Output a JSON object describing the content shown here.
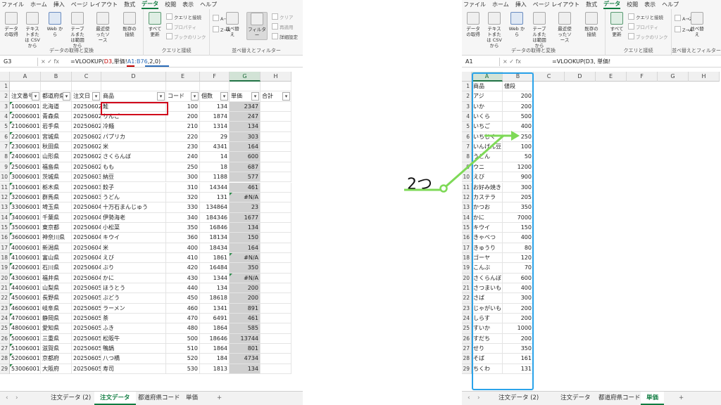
{
  "menu": [
    "ファイル",
    "ホーム",
    "挿入",
    "ページ レイアウト",
    "数式",
    "データ",
    "校閲",
    "表示",
    "ヘルプ"
  ],
  "menu_active": "データ",
  "ribbon": {
    "get_data": "データの取得",
    "text_csv": "テキストまたは CSV から",
    "web": "Web から",
    "table_range": "テーブルまたは範囲から",
    "recent_sources": "最近使ったソース",
    "existing_conn": "既存の接続",
    "group_get_transform": "データの取得と変換",
    "refresh_all": "すべて更新",
    "queries_conn": "クエリと接続",
    "properties": "プロパティ",
    "edit_links": "ブックのリンク",
    "group_queries": "クエリと接続",
    "sort_az": "A→Z",
    "sort_za": "Z→A",
    "sort": "並べ替え",
    "filter": "フィルター",
    "clear": "クリア",
    "reapply": "再適用",
    "advanced": "詳細設定",
    "group_sort_filter": "並べ替えとフィルター"
  },
  "left": {
    "namebox": "G3",
    "fx": "× ✓ fx",
    "formula_pre": "=VLOOKUP(",
    "formula_ref1": "D3",
    "formula_mid": ",単価!",
    "formula_ref2": "A1:B76",
    "formula_post": ",2,0)",
    "columns": [
      "A",
      "B",
      "C",
      "D",
      "E",
      "F",
      "G",
      "H"
    ],
    "headers": [
      "注文番号",
      "都道府県",
      "注文日",
      "商品",
      "コード",
      "個数",
      "単価",
      "合計"
    ],
    "rows": [
      [
        "10006001",
        "北海道",
        "20250602",
        "鮭",
        "100",
        "134",
        "2347"
      ],
      [
        "20006001",
        "青森県",
        "20250602",
        "りんご",
        "200",
        "1874",
        "247"
      ],
      [
        "21006001",
        "岩手県",
        "20250602",
        "冷麺",
        "210",
        "1314",
        "134"
      ],
      [
        "22006001",
        "宮城県",
        "20250602",
        "パプリカ",
        "220",
        "29",
        "303"
      ],
      [
        "23006001",
        "秋田県",
        "20250602",
        "米",
        "230",
        "4341",
        "164"
      ],
      [
        "24006001",
        "山形県",
        "20250602",
        "さくらんぼ",
        "240",
        "14",
        "600"
      ],
      [
        "25006001",
        "福島県",
        "20250602",
        "もも",
        "250",
        "18",
        "687"
      ],
      [
        "30006001",
        "茨城県",
        "20250603",
        "納豆",
        "300",
        "1188",
        "577"
      ],
      [
        "31006001",
        "栃木県",
        "20250603",
        "餃子",
        "310",
        "14344",
        "461"
      ],
      [
        "32006001",
        "群馬県",
        "20250603",
        "うどん",
        "320",
        "131",
        "#N/A"
      ],
      [
        "33006001",
        "埼玉県",
        "20250604",
        "十万石まんじゅう",
        "330",
        "134864",
        "23"
      ],
      [
        "34006001",
        "千葉県",
        "20250604",
        "伊勢海老",
        "340",
        "184346",
        "1677"
      ],
      [
        "35006001",
        "東京都",
        "20250604",
        "小松菜",
        "350",
        "16846",
        "134"
      ],
      [
        "36006001",
        "神奈川県",
        "20250604",
        "キウイ",
        "360",
        "18134",
        "150"
      ],
      [
        "40006001",
        "新潟県",
        "20250604",
        "米",
        "400",
        "18434",
        "164"
      ],
      [
        "41006001",
        "富山県",
        "20250604",
        "えび",
        "410",
        "1861",
        "#N/A"
      ],
      [
        "42006001",
        "石川県",
        "20250604",
        "ぶり",
        "420",
        "16484",
        "350"
      ],
      [
        "43006001",
        "福井県",
        "20250604",
        "かに",
        "430",
        "1344",
        "#N/A"
      ],
      [
        "44006001",
        "山梨県",
        "20250605",
        "ほうとう",
        "440",
        "134",
        "200"
      ],
      [
        "45006001",
        "長野県",
        "20250605",
        "ぶどう",
        "450",
        "18618",
        "200"
      ],
      [
        "46006001",
        "岐阜県",
        "20250605",
        "ラーメン",
        "460",
        "1341",
        "891"
      ],
      [
        "47006001",
        "静岡県",
        "20250605",
        "茶",
        "470",
        "6491",
        "461"
      ],
      [
        "48006001",
        "愛知県",
        "20250605",
        "ふき",
        "480",
        "1864",
        "585"
      ],
      [
        "50006001",
        "三重県",
        "20250605",
        "松阪牛",
        "500",
        "18646",
        "13744"
      ],
      [
        "51006001",
        "滋賀県",
        "20250605",
        "鴨鍋",
        "510",
        "1864",
        "801"
      ],
      [
        "52006001",
        "京都府",
        "20250605",
        "八つ橋",
        "520",
        "184",
        "4734"
      ],
      [
        "53006001",
        "大阪府",
        "20250605",
        "寿司",
        "530",
        "1813",
        "134"
      ]
    ],
    "tabs": [
      "注文データ (2)",
      "注文データ",
      "都道府県コード",
      "単価",
      "+"
    ],
    "active_tab": "注文データ"
  },
  "right": {
    "namebox": "A1",
    "fx": "× ✓ fx",
    "formula_pre": "=VLOOKUP(",
    "formula_ref1": "D3",
    "formula_mid": ", 単価!",
    "columns": [
      "A",
      "B",
      "C",
      "D",
      "E",
      "F",
      "G",
      "H"
    ],
    "headers": [
      "商品",
      "値段"
    ],
    "rows": [
      [
        "アジ",
        "200"
      ],
      [
        "いか",
        "200"
      ],
      [
        "いくら",
        "500"
      ],
      [
        "いちご",
        "400"
      ],
      [
        "いちじく",
        "250"
      ],
      [
        "いんげん豆",
        "100"
      ],
      [
        "うどん",
        "50"
      ],
      [
        "ウニ",
        "1200"
      ],
      [
        "えび",
        "900"
      ],
      [
        "お好み焼き",
        "300"
      ],
      [
        "カステラ",
        "205"
      ],
      [
        "かつお",
        "350"
      ],
      [
        "かに",
        "7000"
      ],
      [
        "キウイ",
        "150"
      ],
      [
        "きゃべつ",
        "400"
      ],
      [
        "きゅうり",
        "80"
      ],
      [
        "ゴーヤ",
        "120"
      ],
      [
        "こんぶ",
        "70"
      ],
      [
        "さくらんぼ",
        "600"
      ],
      [
        "さつまいも",
        "400"
      ],
      [
        "さば",
        "300"
      ],
      [
        "じゃがいも",
        "200"
      ],
      [
        "しらす",
        "200"
      ],
      [
        "すいか",
        "1000"
      ],
      [
        "すだち",
        "200"
      ],
      [
        "せり",
        "350"
      ],
      [
        "そば",
        "161"
      ],
      [
        "ちくわ",
        "131"
      ]
    ],
    "tabs": [
      "注文データ (2)",
      "注文データ",
      "都道府県コード",
      "単価",
      "+"
    ],
    "active_tab": "単価"
  },
  "annotation": {
    "callout_label": "2つ",
    "arrow_color": "#7ed957",
    "highlight_red": "#d0021b",
    "highlight_blue": "#2aa3ea"
  }
}
